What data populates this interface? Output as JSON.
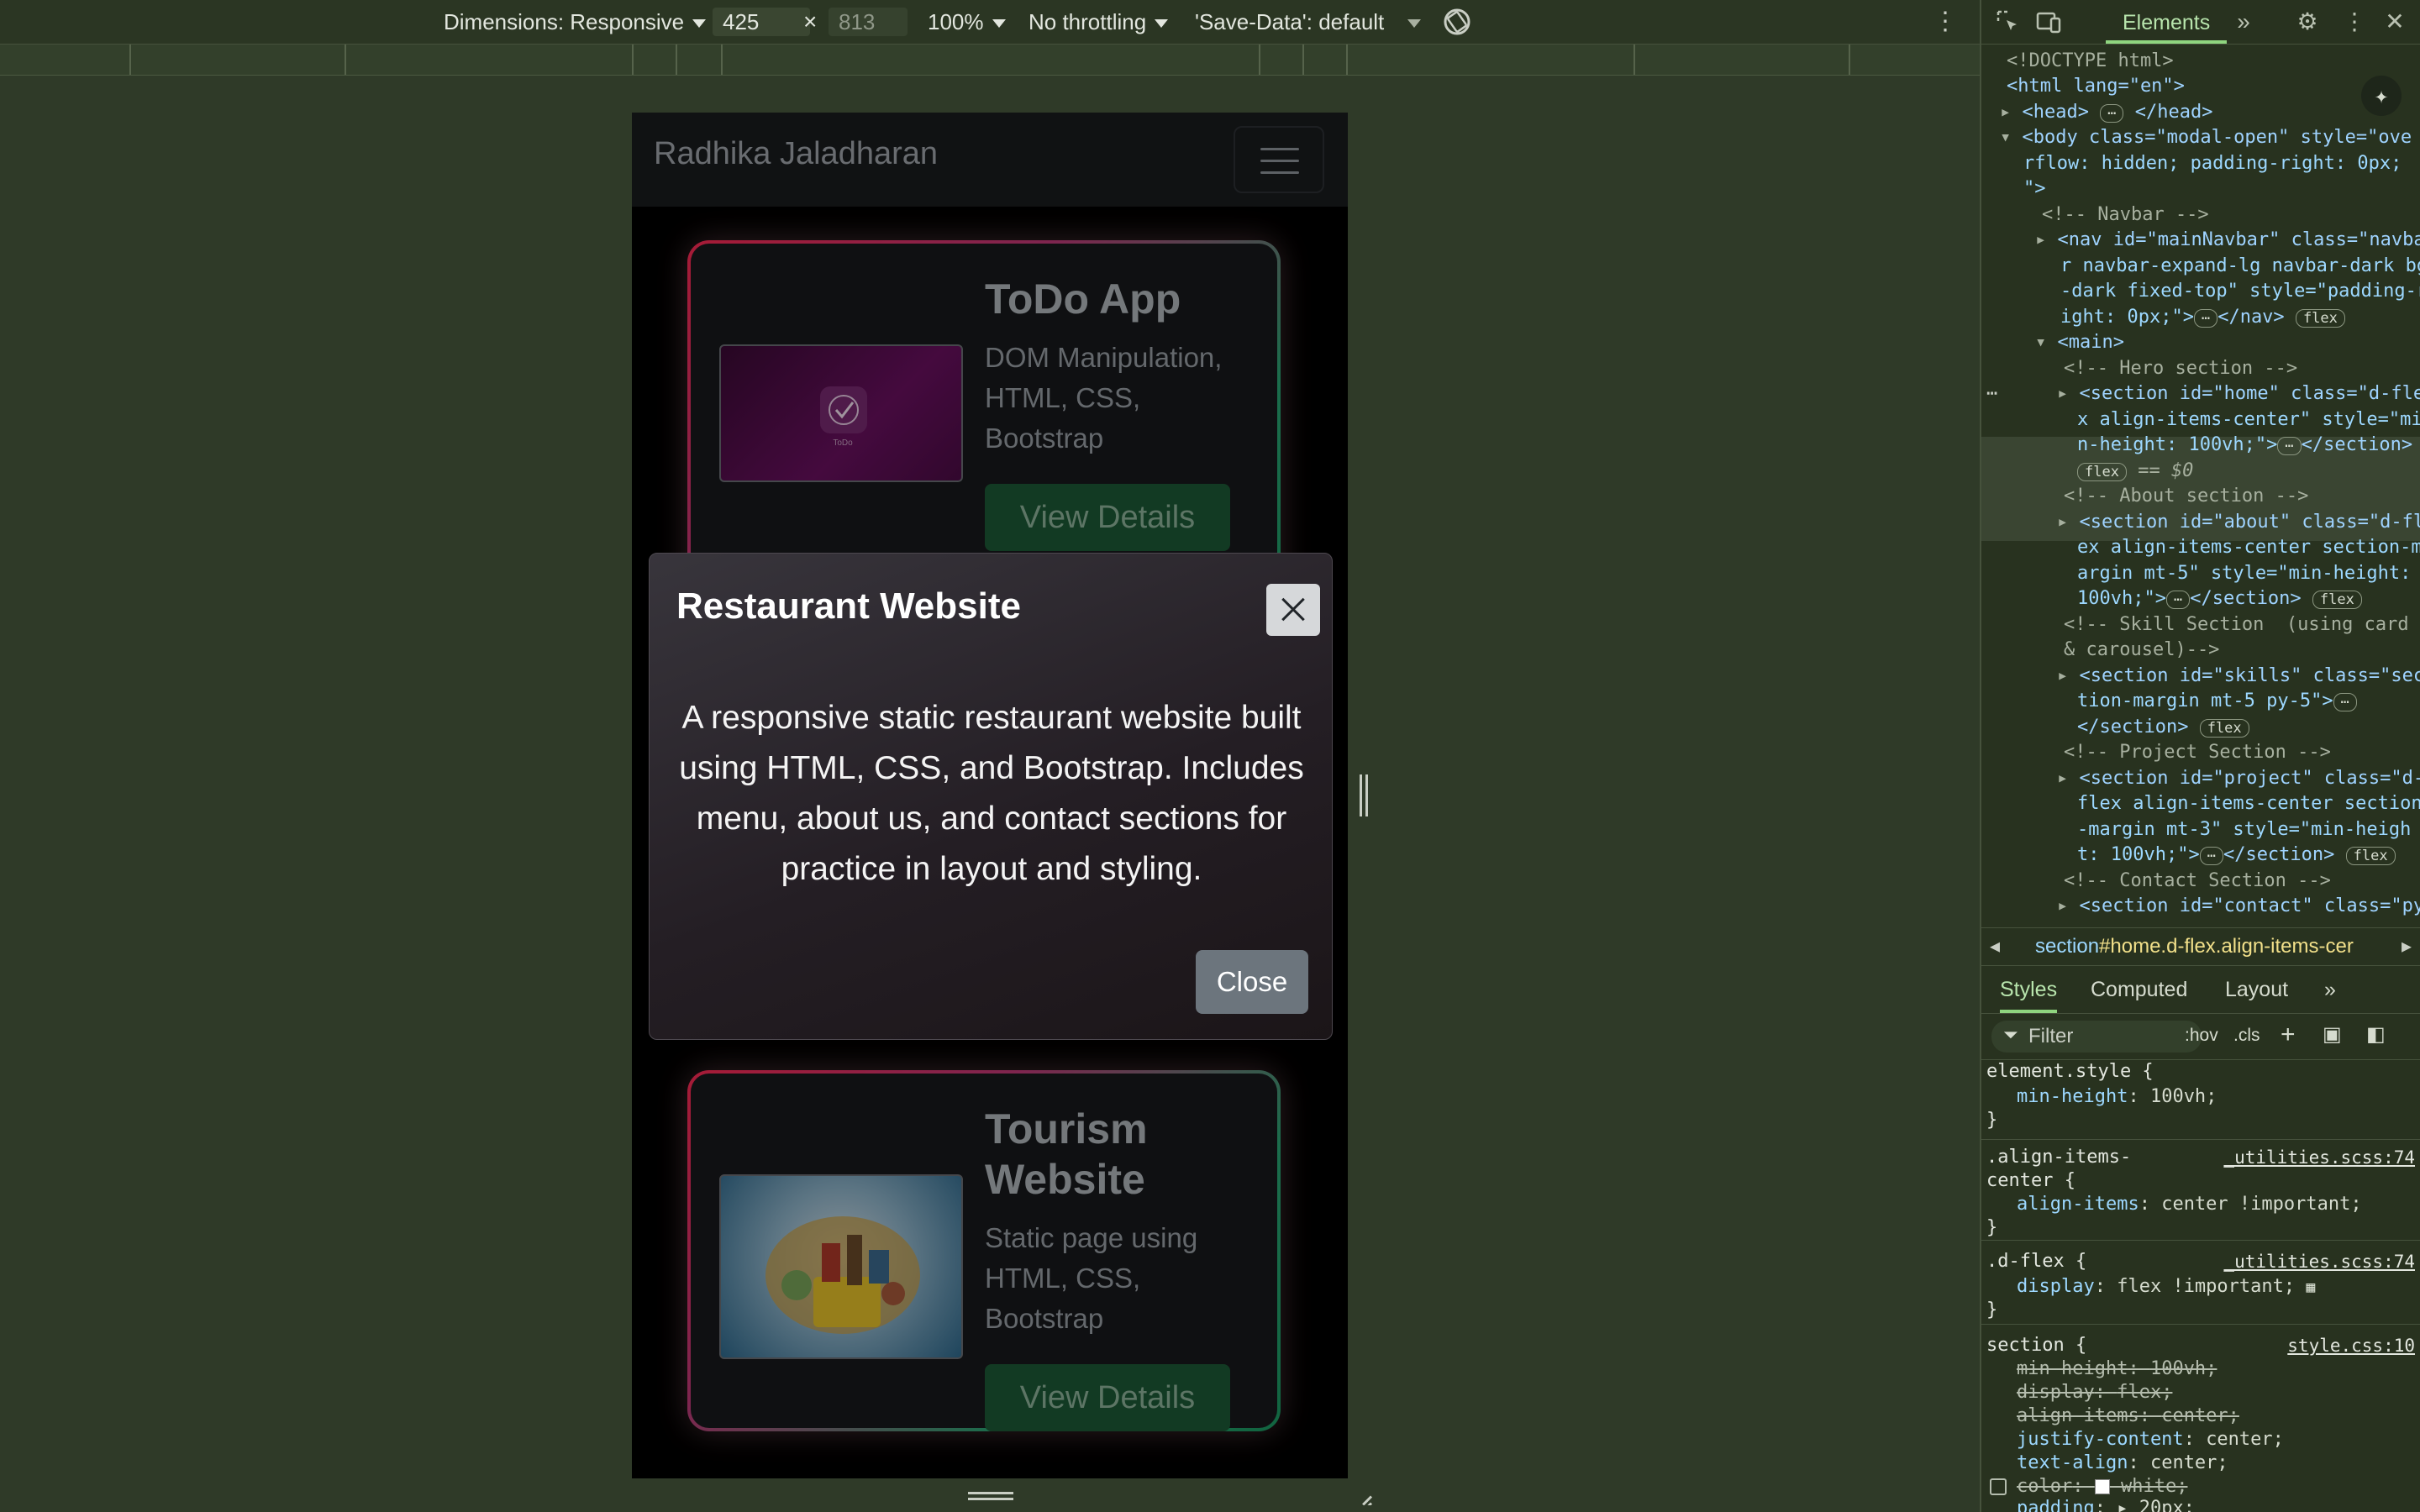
{
  "device_toolbar": {
    "dimensions_label": "Dimensions: Responsive",
    "width": "425",
    "times": "×",
    "height": "813",
    "zoom": "100%",
    "throttling": "No throttling",
    "save_data": "'Save-Data': default"
  },
  "site": {
    "brand": "Radhika Jaladharan",
    "projects": [
      {
        "title": "ToDo App",
        "tech": "DOM Manipulation, HTML, CSS, Bootstrap",
        "button": "View Details",
        "thumb_label": "ToDo"
      },
      {
        "title": "Tourism Website",
        "tech": "Static page using HTML, CSS, Bootstrap",
        "button": "View Details"
      }
    ],
    "modal": {
      "title": "Restaurant Website",
      "body": "A responsive static restaurant website built using HTML, CSS, and Bootstrap. Includes menu, about us, and contact sections for practice in layout and styling.",
      "close_button": "Close"
    }
  },
  "devtools": {
    "active_tab": "Elements",
    "dom_lines": [
      "<!DOCTYPE html>",
      "<html lang=\"en\">",
      "<head>",
      "</head>",
      "<body class=\"modal-open\" style=\"ove",
      "rflow: hidden; padding-right: 0px;",
      "\">",
      "<!-- Navbar -->",
      "<nav id=\"mainNavbar\" class=\"navba",
      "r navbar-expand-lg navbar-dark bg",
      "-dark fixed-top\" style=\"padding-r",
      "ight: 0px;\">",
      "</nav>",
      "<main>",
      "<!-- Hero section -->",
      "<section id=\"home\" class=\"d-fle",
      "x align-items-center\" style=\"mi",
      "n-height: 100vh;\">",
      "</section>",
      "== $0",
      "<!-- About section -->",
      "<section id=\"about\" class=\"d-fl",
      "ex align-items-center section-m",
      "argin mt-5\" style=\"min-height:",
      "100vh;\">",
      "<!-- Skill Section  (using card",
      "& carousel)-->",
      "<section id=\"skills\" class=\"sec",
      "tion-margin mt-5 py-5\">",
      "<!-- Project Section -->",
      "<section id=\"project\" class=\"d-",
      "flex align-items-center section",
      "-margin mt-3\" style=\"min-heigh",
      "t: 100vh;\">",
      "<!-- Contact Section -->",
      "<section id=\"contact\" class=\"py"
    ],
    "pill_flex": "flex",
    "breadcrumb_tag": "section",
    "breadcrumb_rest": "#home.d-flex.align-items-cer",
    "style_tabs": [
      "Styles",
      "Computed",
      "Layout"
    ],
    "filter_placeholder": "Filter",
    "filter_hov": ":hov",
    "filter_cls": ".cls",
    "rules": [
      {
        "selector": "element.style {",
        "source": "",
        "props": [
          [
            "min-height",
            "100vh;"
          ]
        ],
        "close": "}"
      },
      {
        "selector": ".align-items-\ncenter {",
        "source": "_utilities.scss:74",
        "props": [
          [
            "align-items",
            "center !important;"
          ]
        ],
        "close": "}"
      },
      {
        "selector": ".d-flex {",
        "source": "_utilities.scss:74",
        "props": [
          [
            "display",
            "flex !important;"
          ]
        ],
        "close": "}"
      },
      {
        "selector": "section {",
        "source": "style.css:10",
        "props": [
          [
            "min-height",
            "100vh;"
          ],
          [
            "display",
            "flex;"
          ],
          [
            "align-items",
            "center;"
          ],
          [
            "justify-content",
            "center;"
          ],
          [
            "text-align",
            "center;"
          ],
          [
            "color",
            "white;"
          ],
          [
            "padding",
            "20px;"
          ]
        ],
        "close": ""
      }
    ]
  }
}
